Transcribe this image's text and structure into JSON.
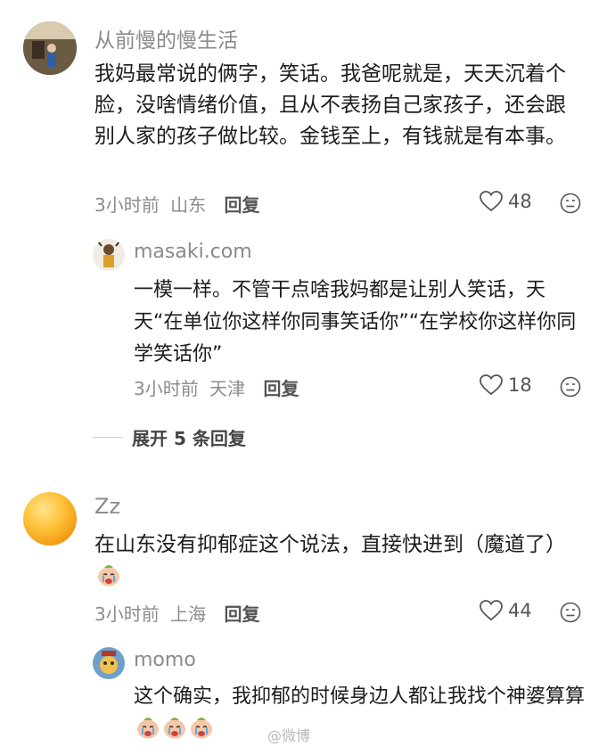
{
  "comments": [
    {
      "username": "从前慢的慢生活",
      "text": "我妈最常说的俩字，笑话。我爸呢就是，天天沉着个脸，没啥情绪价值，且从不表扬自己家孩子，还会跟别人家的孩子做比较。金钱至上，有钱就是有本事。",
      "time": "3小时前",
      "location": "山东",
      "reply_label": "回复",
      "likes": "48",
      "replies": [
        {
          "username": "masaki.com",
          "text": "一模一样。不管干点啥我妈都是让别人笑话，天天“在单位你这样你同事笑话你”“在学校你这样你同学笑话你”",
          "time": "3小时前",
          "location": "天津",
          "reply_label": "回复",
          "likes": "18"
        }
      ],
      "expand_label": "展开 5 条回复"
    },
    {
      "username": "Zz",
      "text": "在山东没有抑郁症这个说法，直接快进到（魔道了）",
      "time": "3小时前",
      "location": "上海",
      "reply_label": "回复",
      "likes": "44",
      "replies": [
        {
          "username": "momo",
          "text": "这个确实，我抑郁的时候身边人都让我找个神婆算算",
          "watermark": "@微博"
        }
      ]
    }
  ],
  "icons": [
    "heart-icon",
    "dislike-icon",
    "crying-emoji"
  ]
}
